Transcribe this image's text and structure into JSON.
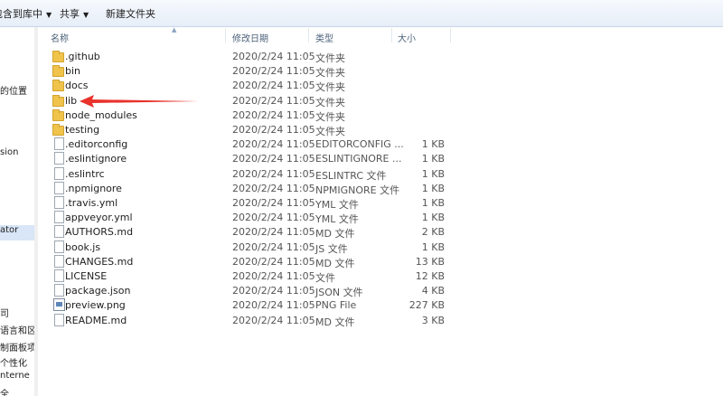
{
  "toolbar": {
    "include_library": "包含到库中",
    "share": "共享",
    "new_folder": "新建文件夹"
  },
  "left_pane": {
    "items": [
      "的位置",
      "sion",
      "ator",
      "司",
      "语言和区",
      "制面板项",
      "个性化",
      "nterne",
      "全"
    ]
  },
  "columns": {
    "name": "名称",
    "date": "修改日期",
    "type": "类型",
    "size": "大小"
  },
  "files": [
    {
      "name": ".github",
      "date": "2020/2/24 11:05",
      "type": "文件夹",
      "size": "",
      "icon": "folder-icon"
    },
    {
      "name": "bin",
      "date": "2020/2/24 11:05",
      "type": "文件夹",
      "size": "",
      "icon": "folder-icon"
    },
    {
      "name": "docs",
      "date": "2020/2/24 11:05",
      "type": "文件夹",
      "size": "",
      "icon": "folder-icon"
    },
    {
      "name": "lib",
      "date": "2020/2/24 11:05",
      "type": "文件夹",
      "size": "",
      "icon": "folder-icon"
    },
    {
      "name": "node_modules",
      "date": "2020/2/24 11:05",
      "type": "文件夹",
      "size": "",
      "icon": "folder-icon"
    },
    {
      "name": "testing",
      "date": "2020/2/24 11:05",
      "type": "文件夹",
      "size": "",
      "icon": "folder-icon"
    },
    {
      "name": ".editorconfig",
      "date": "2020/2/24 11:05",
      "type": "EDITORCONFIG ...",
      "size": "1 KB",
      "icon": "file-icon"
    },
    {
      "name": ".eslintignore",
      "date": "2020/2/24 11:05",
      "type": "ESLINTIGNORE ...",
      "size": "1 KB",
      "icon": "file-icon"
    },
    {
      "name": ".eslintrc",
      "date": "2020/2/24 11:05",
      "type": "ESLINTRC 文件",
      "size": "1 KB",
      "icon": "file-icon"
    },
    {
      "name": ".npmignore",
      "date": "2020/2/24 11:05",
      "type": "NPMIGNORE 文件",
      "size": "1 KB",
      "icon": "file-icon"
    },
    {
      "name": ".travis.yml",
      "date": "2020/2/24 11:05",
      "type": "YML 文件",
      "size": "1 KB",
      "icon": "file-icon"
    },
    {
      "name": "appveyor.yml",
      "date": "2020/2/24 11:05",
      "type": "YML 文件",
      "size": "1 KB",
      "icon": "file-icon"
    },
    {
      "name": "AUTHORS.md",
      "date": "2020/2/24 11:05",
      "type": "MD 文件",
      "size": "2 KB",
      "icon": "file-icon"
    },
    {
      "name": "book.js",
      "date": "2020/2/24 11:05",
      "type": "JS 文件",
      "size": "1 KB",
      "icon": "file-icon"
    },
    {
      "name": "CHANGES.md",
      "date": "2020/2/24 11:05",
      "type": "MD 文件",
      "size": "13 KB",
      "icon": "file-icon"
    },
    {
      "name": "LICENSE",
      "date": "2020/2/24 11:05",
      "type": "文件",
      "size": "12 KB",
      "icon": "file-icon"
    },
    {
      "name": "package.json",
      "date": "2020/2/24 11:05",
      "type": "JSON 文件",
      "size": "4 KB",
      "icon": "file-icon"
    },
    {
      "name": "preview.png",
      "date": "2020/2/24 11:05",
      "type": "PNG File",
      "size": "227 KB",
      "icon": "image-file-icon"
    },
    {
      "name": "README.md",
      "date": "2020/2/24 11:05",
      "type": "MD 文件",
      "size": "3 KB",
      "icon": "file-icon"
    }
  ],
  "colors": {
    "folder": "#f0c44c",
    "annotation_arrow": "#e8322b",
    "selection": "#d8e6f7"
  }
}
